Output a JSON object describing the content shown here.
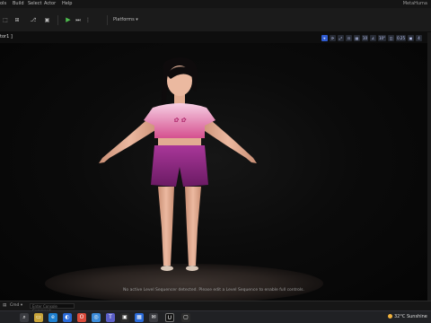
{
  "menu": {
    "items": [
      "ols",
      "Build",
      "Select",
      "Actor",
      "Help"
    ],
    "project": "MetaHuma"
  },
  "toolbar": {
    "platforms_label": "Platforms ▾",
    "play_glyph": "▶",
    "skip_glyph": "⏭",
    "stop_glyph": "⋮"
  },
  "viewport": {
    "tab_label": "tor1 ]",
    "tools": [
      "⌖",
      "⟳",
      "⤢",
      "⊡",
      "▦",
      "10",
      "∠",
      "10°",
      "◫",
      "0.25",
      "▣",
      "4"
    ],
    "sequence_warning": "No active Level Sequencer detected. Please edit a Level Sequence to enable full controls."
  },
  "character": {
    "description": "girl standing in A-pose",
    "top_color": "#e9a3c9",
    "shorts_color": "#9b2b8e",
    "hair_color": "#0e0b0c",
    "skin_color": "#e2ad92"
  },
  "bottom_bar": {
    "drawer_label": "Cmd ▾",
    "cmd_placeholder": "Enter Console Command"
  },
  "taskbar": {
    "temperature": "32°C",
    "weather_label": "Sunshine",
    "apps": [
      "search",
      "file-explorer",
      "edge",
      "photos",
      "chrome",
      "opera",
      "teams",
      "unreal",
      "store",
      "mail"
    ]
  }
}
